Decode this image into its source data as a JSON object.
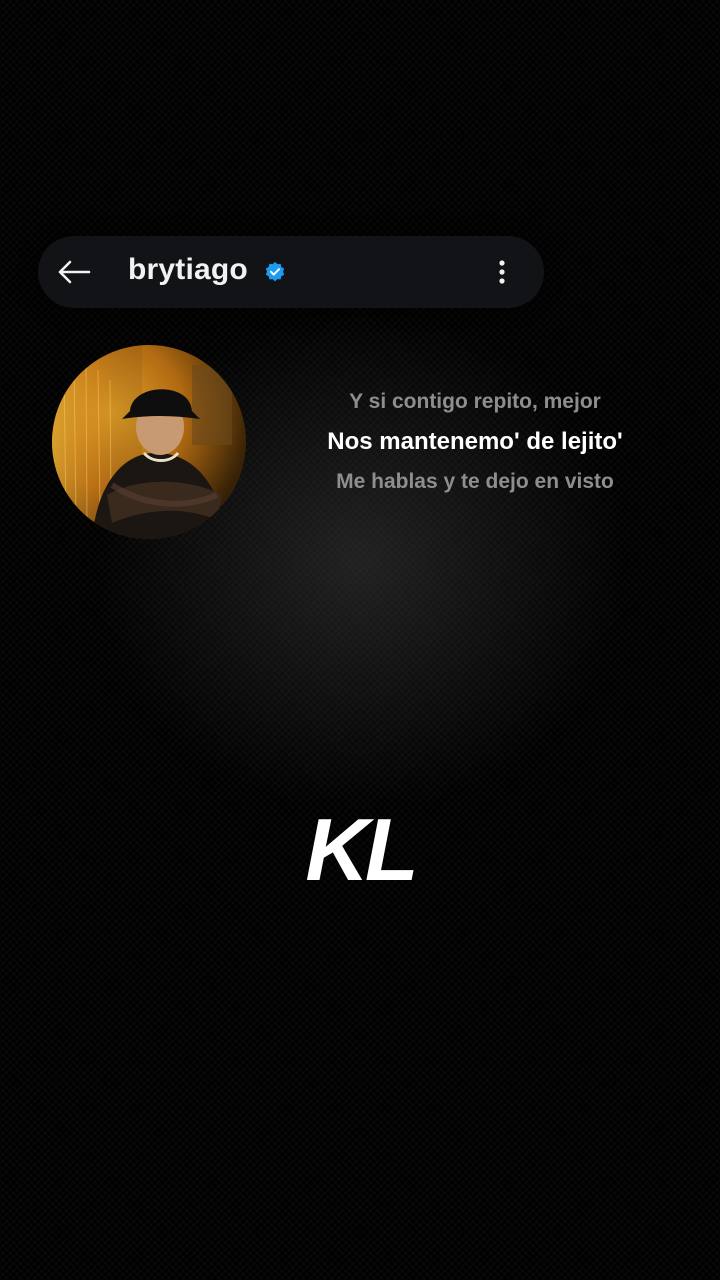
{
  "header": {
    "username": "brytiago",
    "verified_color": "#1d9bf0"
  },
  "lyrics": {
    "previous": "Y si contigo repito, mejor",
    "current": "Nos mantenemo' de lejito'",
    "next": "Me hablas y te dejo en visto"
  },
  "logo": {
    "text": "KL"
  },
  "icons": {
    "back": "arrow-left-icon",
    "verified": "verified-badge-icon",
    "more": "more-vertical-icon"
  }
}
